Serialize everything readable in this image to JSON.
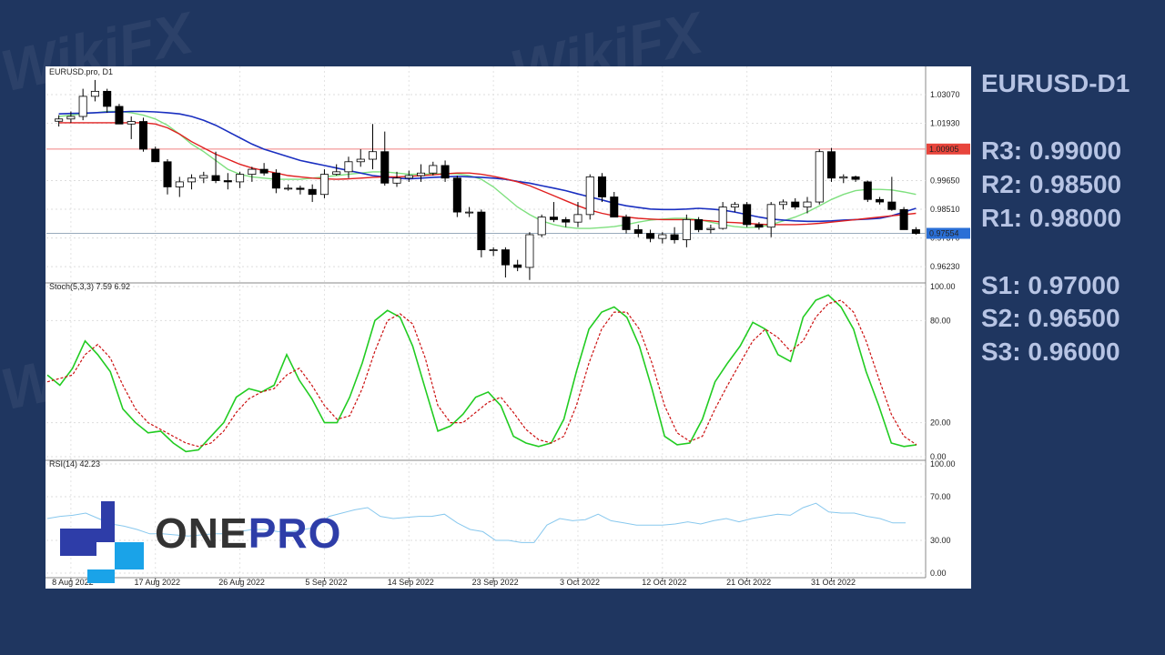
{
  "watermark": "WikiFX",
  "sidebar": {
    "title": "EURUSD-D1",
    "levels": [
      {
        "label": "R3: 0.99000"
      },
      {
        "label": "R2: 0.98500"
      },
      {
        "label": "R1: 0.98000"
      },
      {
        "label": "S1: 0.97000"
      },
      {
        "label": "S2: 0.96500"
      },
      {
        "label": "S3: 0.96000"
      }
    ]
  },
  "logo": {
    "text_a": "ONE",
    "text_b": "PRO",
    "color_a": "#333333",
    "color_b": "#2e3da8",
    "mark_dark": "#2e3da8",
    "mark_light": "#1aa3e8"
  },
  "colors": {
    "bull_fill": "#ffffff",
    "bear_fill": "#000000",
    "ma_red": "#e02020",
    "ma_blue": "#1a2fc0",
    "ma_green": "#7fe07f",
    "stoch_main": "#22cc22",
    "stoch_signal": "#cc1111",
    "rsi": "#88c8ee",
    "price_tag_red": "#e8453c",
    "price_tag_blue": "#2a6fd6"
  },
  "chart_data": [
    {
      "type": "candlestick",
      "title": "EURUSD.pro, D1",
      "ylim": [
        0.958,
        1.039
      ],
      "y_ticks": [
        "1.03070",
        "1.01930",
        "0.99650",
        "0.98510",
        "0.97370",
        "0.96230"
      ],
      "y_tick_values": [
        1.0307,
        1.0193,
        0.9965,
        0.9851,
        0.9737,
        0.9623
      ],
      "marked_prices": [
        {
          "label": "1.00905",
          "value": 1.00905,
          "color": "red"
        },
        {
          "label": "0.97554",
          "value": 0.97554,
          "color": "blue"
        }
      ],
      "x_labels": [
        "8 Aug 2022",
        "17 Aug 2022",
        "26 Aug 2022",
        "5 Sep 2022",
        "14 Sep 2022",
        "23 Sep 2022",
        "3 Oct 2022",
        "12 Oct 2022",
        "21 Oct 2022",
        "31 Oct 2022"
      ],
      "x_label_index": [
        1,
        8,
        15,
        22,
        29,
        36,
        43,
        50,
        57,
        64
      ],
      "candles": [
        [
          1.0201,
          1.0225,
          1.018,
          1.021
        ],
        [
          1.021,
          1.024,
          1.0195,
          1.022
        ],
        [
          1.022,
          1.033,
          1.0205,
          1.03
        ],
        [
          1.03,
          1.0365,
          1.028,
          1.032
        ],
        [
          1.032,
          1.033,
          1.0235,
          1.026
        ],
        [
          1.026,
          1.027,
          1.019,
          1.019
        ],
        [
          1.019,
          1.022,
          1.013,
          1.02
        ],
        [
          1.02,
          1.0215,
          1.008,
          1.009
        ],
        [
          1.009,
          1.01,
          1.004,
          1.004
        ],
        [
          1.004,
          1.005,
          0.991,
          0.994
        ],
        [
          0.994,
          0.998,
          0.99,
          0.996
        ],
        [
          0.996,
          0.999,
          0.993,
          0.9975
        ],
        [
          0.9975,
          1.0,
          0.9955,
          0.9985
        ],
        [
          0.9985,
          1.008,
          0.9955,
          0.9965
        ],
        [
          0.9965,
          0.9995,
          0.993,
          0.996
        ],
        [
          0.996,
          1.0,
          0.9935,
          0.999
        ],
        [
          0.999,
          1.002,
          0.996,
          1.001
        ],
        [
          1.001,
          1.0035,
          0.9985,
          0.9995
        ],
        [
          0.9995,
          1.001,
          0.9915,
          0.9935
        ],
        [
          0.9935,
          0.995,
          0.9925,
          0.9935
        ],
        [
          0.9935,
          0.9945,
          0.991,
          0.993
        ],
        [
          0.993,
          0.995,
          0.988,
          0.991
        ],
        [
          0.991,
          1.001,
          0.9895,
          0.999
        ],
        [
          0.999,
          1.003,
          0.9985,
          1.0
        ],
        [
          1.0,
          1.006,
          0.9975,
          1.004
        ],
        [
          1.004,
          1.009,
          1.002,
          1.005
        ],
        [
          1.005,
          1.019,
          1.001,
          1.008
        ],
        [
          1.008,
          1.016,
          0.9945,
          0.9955
        ],
        [
          0.9955,
          1.0,
          0.994,
          0.9975
        ],
        [
          0.9975,
          1.0005,
          0.996,
          0.9985
        ],
        [
          0.9985,
          1.003,
          0.996,
          0.9995
        ],
        [
          0.9995,
          1.004,
          0.9985,
          1.0025
        ],
        [
          1.0025,
          1.0045,
          0.996,
          0.9975
        ],
        [
          0.9975,
          0.9985,
          0.982,
          0.984
        ],
        [
          0.984,
          0.986,
          0.982,
          0.984
        ],
        [
          0.984,
          0.985,
          0.966,
          0.969
        ],
        [
          0.969,
          0.97,
          0.9665,
          0.969
        ],
        [
          0.969,
          0.97,
          0.958,
          0.963
        ],
        [
          0.963,
          0.965,
          0.9605,
          0.962
        ],
        [
          0.962,
          0.976,
          0.957,
          0.975
        ],
        [
          0.975,
          0.983,
          0.974,
          0.982
        ],
        [
          0.982,
          0.988,
          0.98,
          0.981
        ],
        [
          0.981,
          0.982,
          0.978,
          0.98
        ],
        [
          0.98,
          0.988,
          0.978,
          0.983
        ],
        [
          0.983,
          0.999,
          0.981,
          0.998
        ],
        [
          0.998,
          0.9995,
          0.988,
          0.99
        ],
        [
          0.99,
          0.992,
          0.982,
          0.982
        ],
        [
          0.982,
          0.983,
          0.9755,
          0.977
        ],
        [
          0.977,
          0.979,
          0.974,
          0.9755
        ],
        [
          0.9755,
          0.977,
          0.972,
          0.9735
        ],
        [
          0.9735,
          0.976,
          0.9715,
          0.975
        ],
        [
          0.975,
          0.978,
          0.9715,
          0.973
        ],
        [
          0.973,
          0.983,
          0.97,
          0.981
        ],
        [
          0.981,
          0.982,
          0.976,
          0.977
        ],
        [
          0.977,
          0.979,
          0.9755,
          0.9775
        ],
        [
          0.9775,
          0.988,
          0.977,
          0.986
        ],
        [
          0.986,
          0.988,
          0.984,
          0.987
        ],
        [
          0.987,
          0.988,
          0.978,
          0.979
        ],
        [
          0.979,
          0.98,
          0.977,
          0.978
        ],
        [
          0.978,
          0.988,
          0.974,
          0.987
        ],
        [
          0.987,
          0.989,
          0.985,
          0.988
        ],
        [
          0.988,
          0.9895,
          0.985,
          0.986
        ],
        [
          0.986,
          0.99,
          0.9835,
          0.988
        ],
        [
          0.988,
          1.009,
          0.987,
          1.008
        ],
        [
          1.008,
          1.0095,
          0.996,
          0.9975
        ],
        [
          0.9975,
          0.999,
          0.9955,
          0.998
        ],
        [
          0.998,
          0.9985,
          0.996,
          0.997
        ],
        [
          0.996,
          0.9965,
          0.988,
          0.989
        ],
        [
          0.989,
          0.99,
          0.987,
          0.988
        ],
        [
          0.988,
          0.998,
          0.9845,
          0.985
        ],
        [
          0.985,
          0.986,
          0.977,
          0.977
        ],
        [
          0.977,
          0.978,
          0.975,
          0.9755
        ]
      ],
      "ma_fast_green": [
        1.022,
        1.0225,
        1.023,
        1.0235,
        1.024,
        1.024,
        1.0235,
        1.0225,
        1.021,
        1.0185,
        1.015,
        1.011,
        1.008,
        1.0045,
        1.001,
        0.999,
        0.998,
        0.9975,
        0.997,
        0.997,
        0.997,
        0.9975,
        0.998,
        0.9985,
        0.999,
        0.9995,
        1.0,
        1.0,
        0.9995,
        0.999,
        0.999,
        0.9992,
        0.9993,
        0.9992,
        0.9985,
        0.997,
        0.994,
        0.99,
        0.986,
        0.983,
        0.9805,
        0.979,
        0.978,
        0.9775,
        0.9775,
        0.9778,
        0.9782,
        0.979,
        0.98,
        0.9808,
        0.9812,
        0.9815,
        0.9815,
        0.981,
        0.98,
        0.979,
        0.9782,
        0.9778,
        0.978,
        0.979,
        0.9805,
        0.982,
        0.984,
        0.9865,
        0.989,
        0.991,
        0.9925,
        0.993,
        0.993,
        0.9928,
        0.992,
        0.991
      ],
      "ma_red": [
        1.0195,
        1.0195,
        1.0195,
        1.0195,
        1.0195,
        1.0195,
        1.0195,
        1.0195,
        1.019,
        1.0175,
        1.015,
        1.012,
        1.0095,
        1.007,
        1.005,
        1.003,
        1.0015,
        1.0005,
        0.9995,
        0.9985,
        0.998,
        0.9975,
        0.9972,
        0.997,
        0.9972,
        0.9975,
        0.9978,
        0.998,
        0.998,
        0.9982,
        0.9985,
        0.9988,
        0.9992,
        0.9995,
        0.9995,
        0.999,
        0.9982,
        0.9972,
        0.996,
        0.9945,
        0.9925,
        0.9905,
        0.9885,
        0.9865,
        0.9848,
        0.9835,
        0.9825,
        0.982,
        0.9815,
        0.9812,
        0.981,
        0.981,
        0.981,
        0.9808,
        0.9805,
        0.98,
        0.9798,
        0.9795,
        0.9792,
        0.979,
        0.979,
        0.979,
        0.9792,
        0.9795,
        0.98,
        0.9805,
        0.981,
        0.9815,
        0.982,
        0.9825,
        0.983,
        0.9835
      ],
      "ma_blue": [
        1.023,
        1.0232,
        1.0233,
        1.0235,
        1.0237,
        1.0238,
        1.024,
        1.024,
        1.0238,
        1.0235,
        1.023,
        1.022,
        1.0205,
        1.0185,
        1.016,
        1.0135,
        1.011,
        1.009,
        1.0075,
        1.006,
        1.0045,
        1.0035,
        1.0025,
        1.0015,
        1.0005,
        0.9995,
        0.9985,
        0.998,
        0.9975,
        0.9972,
        0.9975,
        0.9978,
        0.998,
        0.9982,
        0.998,
        0.9978,
        0.9975,
        0.997,
        0.9962,
        0.9955,
        0.9945,
        0.9935,
        0.9925,
        0.9912,
        0.99,
        0.9888,
        0.9875,
        0.9865,
        0.9858,
        0.9852,
        0.985,
        0.985,
        0.9852,
        0.9855,
        0.9852,
        0.9848,
        0.984,
        0.983,
        0.982,
        0.9812,
        0.9808,
        0.9805,
        0.9803,
        0.9803,
        0.9805,
        0.9808,
        0.981,
        0.9812,
        0.9815,
        0.9825,
        0.984,
        0.9855
      ]
    },
    {
      "type": "line",
      "title": "Stoch(5,3,3) 7.59 6.92",
      "ylim": [
        0,
        100
      ],
      "y_ticks": [
        "100.00",
        "80.00",
        "20.00",
        "0.00"
      ],
      "y_tick_values": [
        100,
        80,
        20,
        0
      ],
      "series": [
        {
          "values": [
            48,
            42,
            52,
            68,
            60,
            50,
            28,
            20,
            14,
            15,
            8,
            3,
            4,
            12,
            20,
            35,
            40,
            38,
            42,
            60,
            45,
            34,
            20,
            20,
            35,
            55,
            80,
            86,
            82,
            65,
            40,
            15,
            18,
            25,
            35,
            38,
            30,
            12,
            8,
            6,
            8,
            22,
            50,
            75,
            85,
            88,
            82,
            65,
            40,
            12,
            7,
            8,
            22,
            44,
            55,
            65,
            79,
            75,
            60,
            56,
            82,
            92,
            95,
            88,
            75,
            50,
            30,
            8,
            6,
            7
          ]
        },
        {
          "values": [
            44,
            46,
            48,
            60,
            66,
            58,
            42,
            28,
            20,
            16,
            12,
            8,
            6,
            8,
            15,
            26,
            34,
            38,
            40,
            48,
            52,
            42,
            30,
            22,
            24,
            40,
            62,
            80,
            84,
            78,
            58,
            30,
            20,
            20,
            26,
            32,
            35,
            26,
            16,
            10,
            8,
            12,
            30,
            55,
            75,
            85,
            85,
            75,
            55,
            30,
            14,
            9,
            12,
            28,
            42,
            55,
            68,
            75,
            70,
            62,
            68,
            82,
            90,
            92,
            85,
            68,
            46,
            25,
            12,
            7
          ]
        }
      ]
    },
    {
      "type": "line",
      "title": "RSI(14) 42.23",
      "ylim": [
        0,
        100
      ],
      "y_ticks": [
        "100.00",
        "70.00",
        "30.00",
        "0.00"
      ],
      "y_tick_values": [
        100,
        70,
        30,
        0
      ],
      "series": [
        {
          "values": [
            50,
            52,
            53,
            55,
            50,
            45,
            43,
            40,
            36,
            36,
            35,
            34,
            35,
            36,
            36,
            38,
            40,
            40,
            38,
            38,
            40,
            42,
            52,
            55,
            58,
            60,
            52,
            50,
            51,
            52,
            52,
            54,
            46,
            40,
            38,
            30,
            30,
            28,
            28,
            44,
            50,
            48,
            49,
            54,
            48,
            46,
            44,
            44,
            44,
            45,
            47,
            45,
            48,
            50,
            47,
            50,
            52,
            54,
            53,
            60,
            64,
            56,
            55,
            55,
            52,
            50,
            46,
            46
          ]
        }
      ]
    }
  ]
}
